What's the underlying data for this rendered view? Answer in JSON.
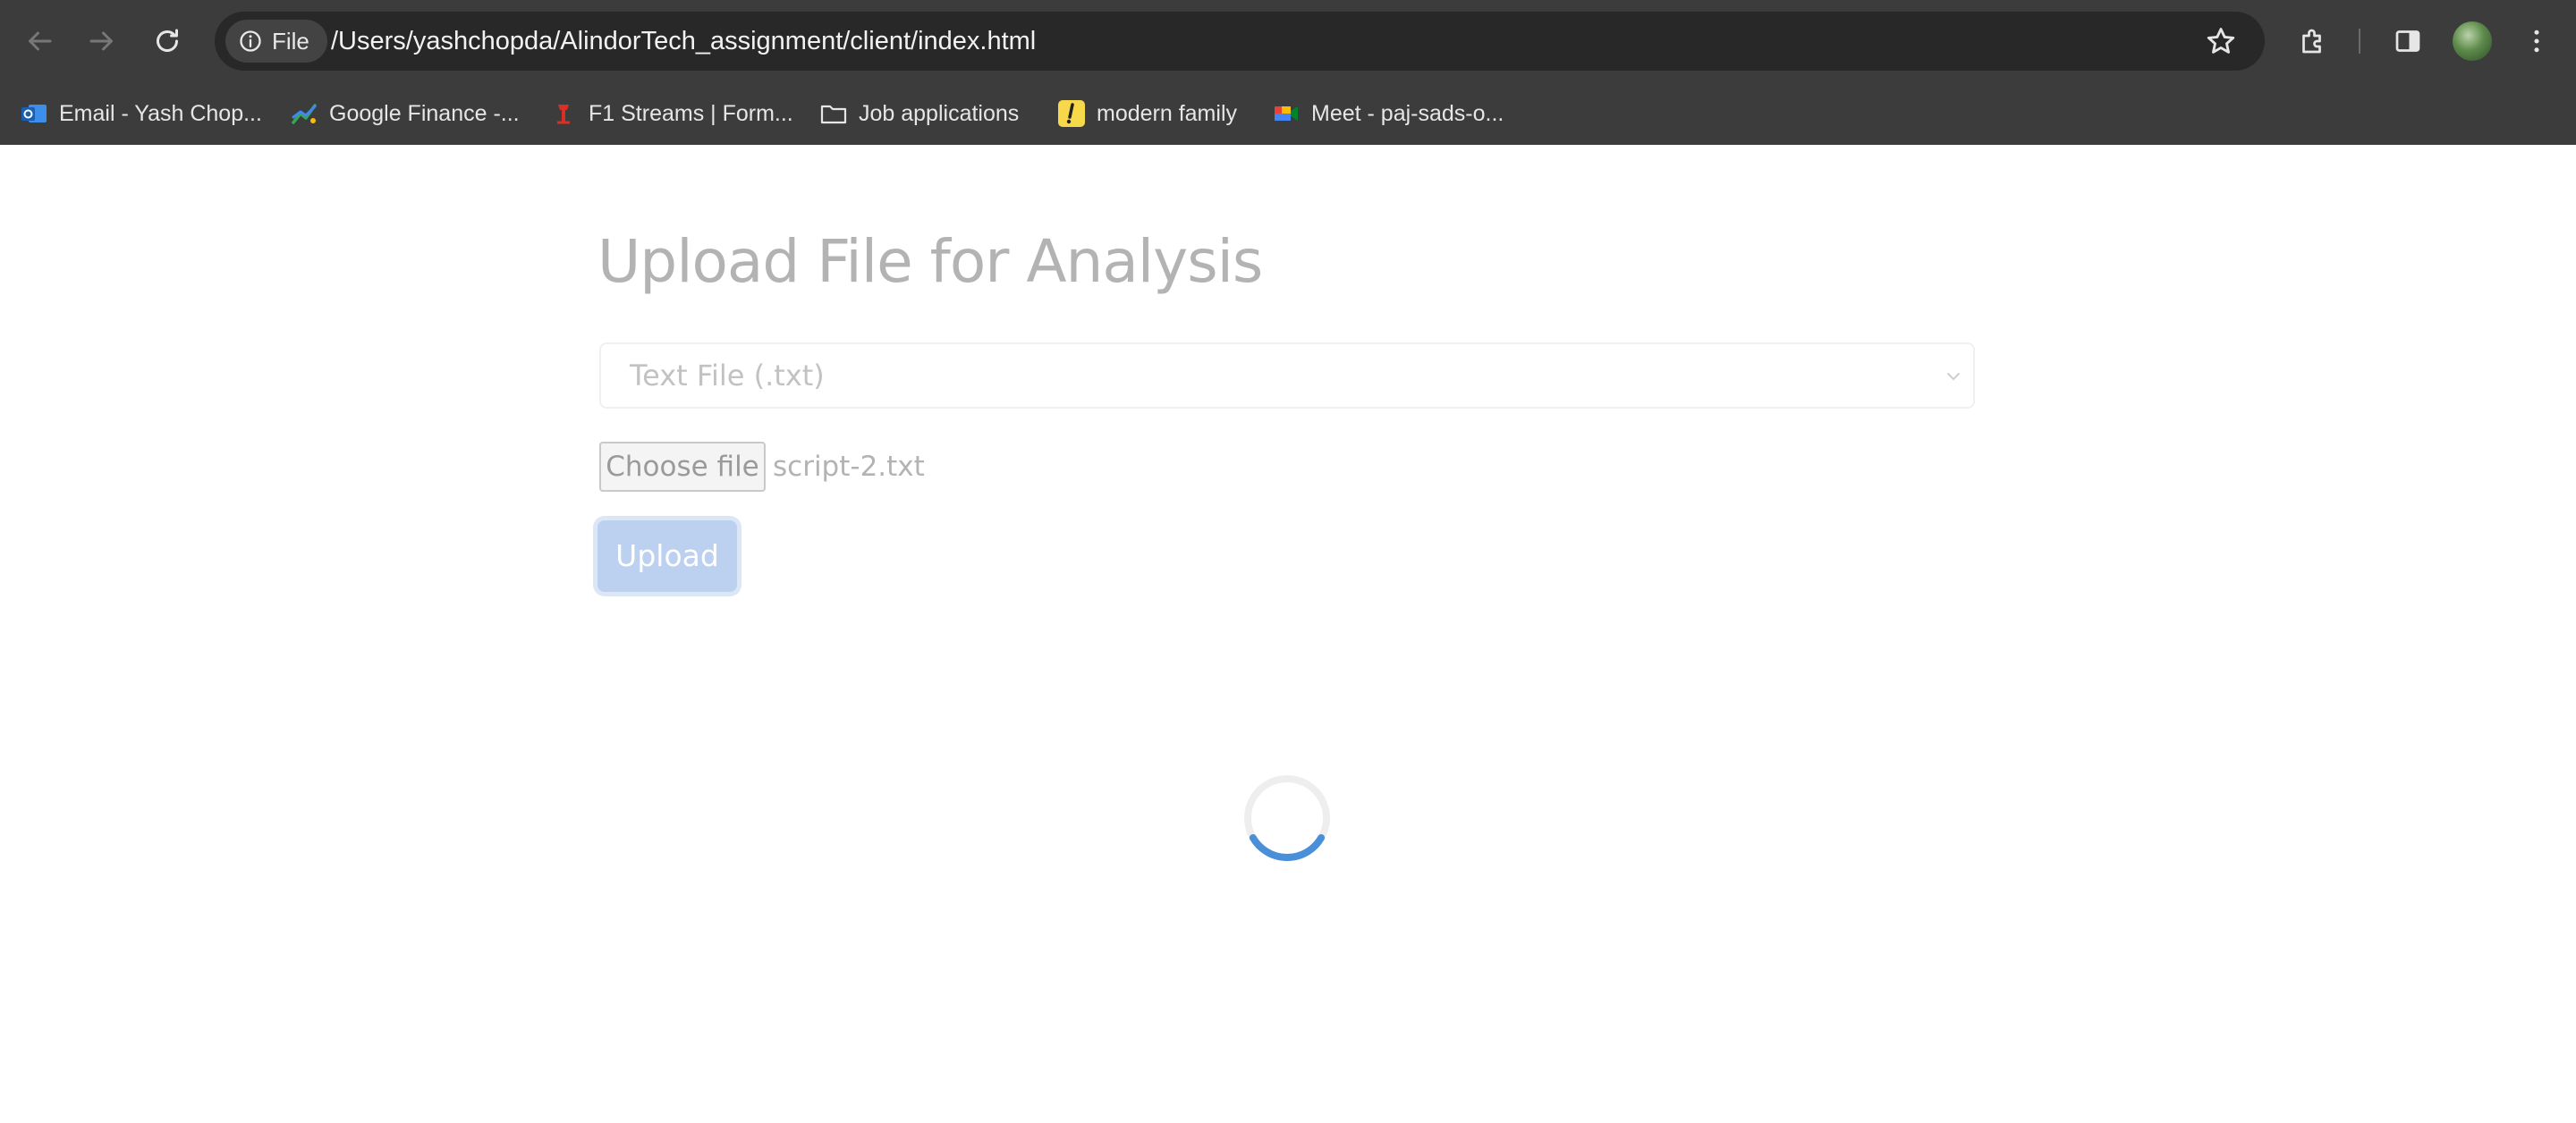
{
  "browser": {
    "site_chip_label": "File",
    "url": "/Users/yashchopda/AlindorTech_assignment/client/index.html",
    "bookmarks": [
      {
        "label": "Email - Yash Chop...",
        "icon": "outlook-icon"
      },
      {
        "label": "Google Finance -...",
        "icon": "google-finance-icon"
      },
      {
        "label": "F1 Streams | Form...",
        "icon": "f1-streams-icon"
      },
      {
        "label": "Job applications",
        "icon": "folder-icon"
      },
      {
        "label": "modern family",
        "icon": "exclamation-icon"
      },
      {
        "label": "Meet - paj-sads-o...",
        "icon": "google-meet-icon"
      }
    ]
  },
  "page": {
    "title": "Upload File for Analysis",
    "file_type_select": {
      "selected": "Text File (.txt)"
    },
    "file_input": {
      "button_label": "Choose file",
      "file_name": "script-2.txt"
    },
    "upload_button": "Upload",
    "loading": true
  },
  "colors": {
    "chrome_bg": "#3c3c3c",
    "omnibox_bg": "#282828",
    "upload_button_bg": "#bcd0ef",
    "spinner_accent": "#4a90d9",
    "spinner_track": "#eeeeee"
  }
}
